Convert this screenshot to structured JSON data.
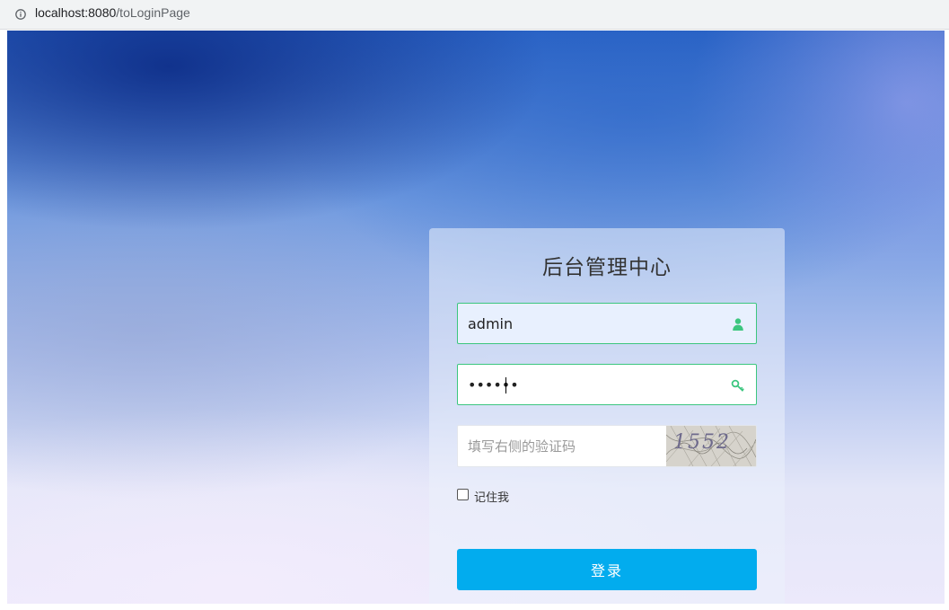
{
  "browser": {
    "url_host": "localhost:8080",
    "url_path": "/toLoginPage"
  },
  "login": {
    "title": "后台管理中心",
    "username_value": "admin",
    "password_value": "••••••",
    "captcha_placeholder": "填写右侧的验证码",
    "captcha_image_text": "1552",
    "remember_label": "记住我",
    "remember_checked": false,
    "submit_label": "登录"
  },
  "icons": {
    "address_info": "info-icon",
    "username": "user-icon",
    "password": "key-icon"
  },
  "colors": {
    "accent_green": "#3cc67f",
    "button_blue": "#02acee"
  }
}
